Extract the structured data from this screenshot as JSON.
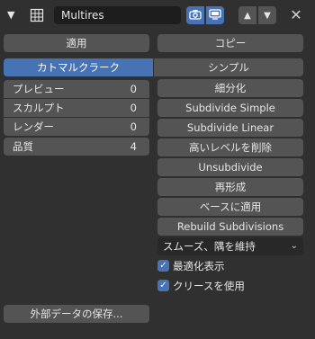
{
  "header": {
    "collapse_glyph": "▼",
    "modifier_icon": "multires-grid-icon",
    "name": "Multires",
    "toggle_render_icon": "camera-icon",
    "toggle_viewport_icon": "monitor-icon",
    "move_up_glyph": "▲",
    "move_down_glyph": "▼",
    "close_glyph": "✕",
    "accent": "#4772b3"
  },
  "actions": {
    "apply": "適用",
    "copy": "コピー"
  },
  "subdivision_type": {
    "options": [
      "カトマルクラーク",
      "シンプル"
    ],
    "selected": "カトマルクラーク"
  },
  "levels": [
    {
      "label": "プレビュー",
      "value": "0"
    },
    {
      "label": "スカルプト",
      "value": "0"
    },
    {
      "label": "レンダー",
      "value": "0"
    }
  ],
  "quality": {
    "label": "品質",
    "value": "4"
  },
  "ops": [
    "細分化",
    "Subdivide Simple",
    "Subdivide Linear",
    "高いレベルを削除",
    "Unsubdivide",
    "再形成",
    "ベースに適用",
    "Rebuild Subdivisions"
  ],
  "uv_smooth": {
    "value": "スムーズ、隅を維持"
  },
  "checkboxes": [
    {
      "label": "最適化表示",
      "checked": true
    },
    {
      "label": "クリースを使用",
      "checked": true
    }
  ],
  "save_external": "外部データの保存..."
}
